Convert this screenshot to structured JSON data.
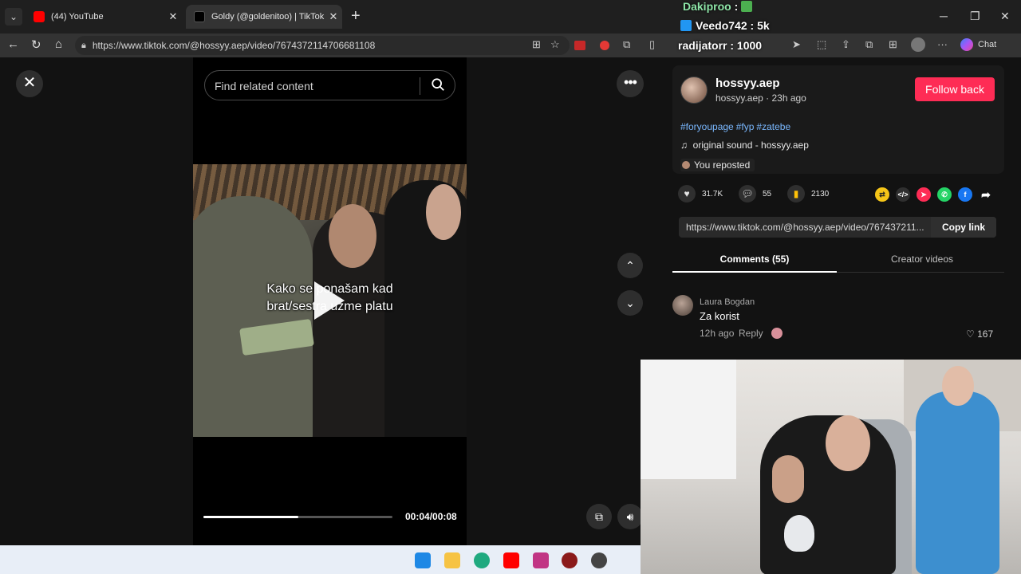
{
  "browser": {
    "tabs": [
      {
        "label": "(44) YouTube"
      },
      {
        "label": "Goldy (@goldenitoo) | TikTok"
      }
    ],
    "url": "https://www.tiktok.com/@hossyy.aep/video/7674372114706681108",
    "chat_label": "Chat"
  },
  "stream_overlay": {
    "lines": [
      {
        "name": "Dakiproo",
        "value": ""
      },
      {
        "name": "Veedo742",
        "value": "5k"
      },
      {
        "name": "radijatorr",
        "value": "1000"
      }
    ]
  },
  "player": {
    "search_placeholder": "Find related content",
    "caption_line1": "Kako se ponašam kad",
    "caption_line2": "brat/sestra uzme platu",
    "time": "00:04/00:08",
    "progress": 0.5
  },
  "post": {
    "username": "hossyy.aep",
    "meta": "hossyy.aep · 23h ago",
    "follow_label": "Follow back",
    "hashtags": [
      "#foryoupage",
      "#fyp",
      "#zatebe"
    ],
    "sound": "original sound - hossyy.aep",
    "repost_label": "You reposted",
    "likes": "31.7K",
    "comments_count": "55",
    "saves": "2130",
    "link": "https://www.tiktok.com/@hossyy.aep/video/767437211...",
    "copy_label": "Copy link"
  },
  "tabs": {
    "comments": "Comments (55)",
    "creator": "Creator videos"
  },
  "comments": [
    {
      "author": "Laura Bogdan",
      "text": "Za korist",
      "time": "12h ago",
      "reply": "Reply",
      "likes": "167"
    }
  ],
  "colors": {
    "accent": "#fe2c55",
    "hashtag": "#7ab8ff",
    "page_bg": "#121212"
  }
}
